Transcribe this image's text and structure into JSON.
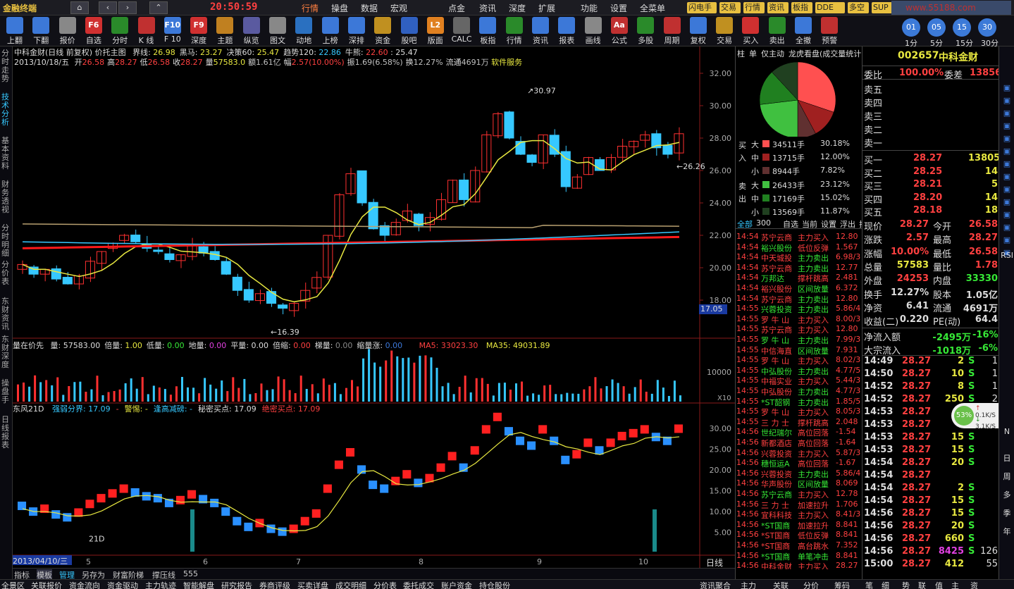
{
  "app": {
    "brand": "金融终端",
    "clock": "20:50:59"
  },
  "topmenu": [
    "行情",
    "操盘",
    "数据",
    "宏观",
    "点金",
    "资讯",
    "深度",
    "扩展",
    "功能",
    "设置",
    "全菜单"
  ],
  "toptags": [
    "闪电手",
    "交易",
    "行情",
    "资讯",
    "板指",
    "DDE",
    "多空",
    "SUP",
    "博弈",
    "驱动力"
  ],
  "watermark": "www.55188.com",
  "toolbar": [
    {
      "label": "上翻",
      "icon": "arrow-up-icon",
      "color": "#3c78d8"
    },
    {
      "label": "下翻",
      "icon": "arrow-down-icon",
      "color": "#3c78d8"
    },
    {
      "label": "报价",
      "icon": "quote-icon",
      "color": "#888"
    },
    {
      "label": "自选",
      "icon": "F6",
      "color": "#d03030"
    },
    {
      "label": "分时",
      "icon": "timeshare-icon",
      "color": "#2a8a2a"
    },
    {
      "label": "K 线",
      "icon": "kline-icon",
      "color": "#c03030"
    },
    {
      "label": "F 10",
      "icon": "F10",
      "color": "#3c78d8"
    },
    {
      "label": "深度",
      "icon": "F9",
      "color": "#d03030"
    },
    {
      "label": "主题",
      "icon": "theme-icon",
      "color": "#c08020"
    },
    {
      "label": "纵览",
      "icon": "overview-icon",
      "color": "#5a5aa0"
    },
    {
      "label": "图文",
      "icon": "graphic-icon",
      "color": "#888"
    },
    {
      "label": "动地",
      "icon": "dynamic-icon",
      "color": "#2a70c0"
    },
    {
      "label": "上榜",
      "icon": "rank-icon",
      "color": "#3c78d8"
    },
    {
      "label": "深排",
      "icon": "sort-icon",
      "color": "#3c78d8"
    },
    {
      "label": "资金",
      "icon": "fund-icon",
      "color": "#c09020"
    },
    {
      "label": "股吧",
      "icon": "forum-icon",
      "color": "#3060c0"
    },
    {
      "label": "版面",
      "icon": "L2",
      "color": "#e08020"
    },
    {
      "label": "CALC",
      "icon": "calc-icon",
      "color": "#666"
    },
    {
      "label": "板指",
      "icon": "board-icon",
      "color": "#3c78d8"
    },
    {
      "label": "行情",
      "icon": "market-icon",
      "color": "#2a8a2a"
    },
    {
      "label": "资讯",
      "icon": "news-icon",
      "color": "#3c78d8"
    },
    {
      "label": "报表",
      "icon": "report-icon",
      "color": "#3c78d8"
    },
    {
      "label": "画线",
      "icon": "draw-icon",
      "color": "#888"
    },
    {
      "label": "公式",
      "icon": "Aa",
      "color": "#c03030"
    },
    {
      "label": "多股",
      "icon": "multi-icon",
      "color": "#2a8a2a"
    },
    {
      "label": "周期",
      "icon": "period-icon",
      "color": "#c03030"
    },
    {
      "label": "复权",
      "icon": "adjust-icon",
      "color": "#3c78d8"
    },
    {
      "label": "交易",
      "icon": "trade-icon",
      "color": "#c09020"
    },
    {
      "label": "买入",
      "icon": "buy-icon",
      "color": "#d03030"
    },
    {
      "label": "卖出",
      "icon": "sell-icon",
      "color": "#2a8a2a"
    },
    {
      "label": "全撤",
      "icon": "cancel-icon",
      "color": "#3c78d8"
    },
    {
      "label": "预警",
      "icon": "alert-icon",
      "color": "#c03030"
    }
  ],
  "periods": [
    {
      "n": "01",
      "l": "1分"
    },
    {
      "n": "05",
      "l": "5分"
    },
    {
      "n": "15",
      "l": "15分"
    },
    {
      "n": "30",
      "l": "30分"
    }
  ],
  "lefttabs": [
    "分时走势",
    "技术分析",
    "基本资料",
    "财务透视",
    "分时明细",
    "分价表",
    "东财资讯",
    "东财深度",
    "操盘手",
    "日线报表"
  ],
  "chart": {
    "title": "中科金财(日线 前复权) 价托主图",
    "indicators": [
      {
        "k": "界线",
        "v": "26.98",
        "c": "#e8e840"
      },
      {
        "k": "黑马",
        "v": "23.27",
        "c": "#e8e840"
      },
      {
        "k": "决策60",
        "v": "25.47",
        "c": "#e8e840"
      },
      {
        "k": "趋势120",
        "v": "22.86",
        "c": "#36c8ff"
      },
      {
        "k": "牛熊",
        "v": "22.60",
        "c": "#ff4040"
      }
    ],
    "extra": "25.47",
    "info_date": "2013/10/18/五",
    "info": [
      {
        "k": "开",
        "v": "26.58",
        "c": "#ff4040"
      },
      {
        "k": "高",
        "v": "28.27",
        "c": "#ff4040"
      },
      {
        "k": "低",
        "v": "26.58",
        "c": "#ff4040"
      },
      {
        "k": "收",
        "v": "28.27",
        "c": "#ff4040"
      },
      {
        "k": "量",
        "v": "57583.0",
        "c": "#e8e840"
      },
      {
        "k": "额",
        "v": "1.61亿",
        "c": "#c0c0c0"
      },
      {
        "k": "幅",
        "v": "2.57(10.00%)",
        "c": "#ff4040"
      },
      {
        "k": "振",
        "v": "1.69(6.58%)",
        "c": "#c0c0c0"
      },
      {
        "k": "换",
        "v": "12.27%",
        "c": "#c0c0c0"
      },
      {
        "k": "流通",
        "v": "4691万",
        "c": "#c0c0c0"
      }
    ],
    "sector": "软件服务",
    "yticks": [
      "32.00",
      "30.00",
      "28.00",
      "26.00",
      "24.00",
      "22.00",
      "20.00",
      "18.00"
    ],
    "high_label": "30.97",
    "low_label": "16.39",
    "last_label": "26.26",
    "cursor_price": "17.05",
    "vol_title": "量在价先",
    "vol_items": [
      {
        "k": "量",
        "v": "57583.00",
        "c": "#ddd"
      },
      {
        "k": "倍量",
        "v": "1.00",
        "c": "#e8e840"
      },
      {
        "k": "低量",
        "v": "0.00",
        "c": "#36e836"
      },
      {
        "k": "地量",
        "v": "0.00",
        "c": "#e040e0"
      },
      {
        "k": "平量",
        "v": "0.00",
        "c": "#ddd"
      },
      {
        "k": "倍缩",
        "v": "0.00",
        "c": "#ff4040"
      },
      {
        "k": "梯量",
        "v": "0.00",
        "c": "#888"
      },
      {
        "k": "缩量涨",
        "v": "0.00",
        "c": "#3c78d8"
      }
    ],
    "ma5": "MA5: 33023.30",
    "ma35": "MA35: 49031.89",
    "vol_ytick": "10000",
    "vol_unit": "X10",
    "ind_title": "东风21D",
    "ind_items": [
      {
        "t": "强弱分界: 17.09",
        "c": "#36c8ff"
      },
      {
        "t": "-",
        "c": "#ff4040"
      },
      {
        "t": "警惕: -",
        "c": "#e8e840"
      },
      {
        "t": "逢高减磅: -",
        "c": "#36c8ff"
      },
      {
        "t": "秘密买点: 17.09",
        "c": "#ddd"
      },
      {
        "t": "绝密买点: 17.09",
        "c": "#ff4040"
      }
    ],
    "ind_yticks": [
      "30.00",
      "25.00",
      "20.00",
      "15.00",
      "10.00",
      "5.00"
    ],
    "ind_label": "21D",
    "date_cursor": "2013/04/10/三",
    "date_ticks": [
      "5",
      "6",
      "7",
      "8",
      "9",
      "10"
    ],
    "period": "日线"
  },
  "bottomtabs": [
    "指标",
    "模板",
    "管理",
    "另存为",
    "财富阶梯",
    "撑压线",
    "555"
  ],
  "statusbar": [
    "全景区",
    "关联报价",
    "资金流向",
    "资金驱动",
    "主力轨迹",
    "智能解盘",
    "研究报告",
    "券商评级",
    "买卖详盘",
    "成交明细",
    "分价表",
    "委托成交",
    "账户资金",
    "持仓股份"
  ],
  "statusbar_right": [
    "资讯聚合",
    "主力",
    "关联",
    "分价",
    "筹码",
    "笔",
    "细",
    "势",
    "联",
    "值",
    "主",
    "资"
  ],
  "mid": {
    "tabs": [
      "柱",
      "单",
      "仅主动",
      "龙虎看盘(成交量统计)"
    ],
    "flow_in": {
      "side": "买入",
      "rows": [
        {
          "k": "大",
          "v": "34511手",
          "p": "30.18%",
          "c": "#ff5050"
        },
        {
          "k": "中",
          "v": "13715手",
          "p": "12.00%",
          "c": "#a02020"
        },
        {
          "k": "小",
          "v": "8944手",
          "p": "7.82%",
          "c": "#603030"
        }
      ]
    },
    "flow_out": {
      "side": "卖出",
      "rows": [
        {
          "k": "大",
          "v": "26433手",
          "p": "23.12%",
          "c": "#40c040"
        },
        {
          "k": "中",
          "v": "17169手",
          "p": "15.02%",
          "c": "#208020"
        },
        {
          "k": "小",
          "v": "13569手",
          "p": "11.87%",
          "c": "#204020"
        }
      ]
    },
    "pie": [
      30.18,
      12.0,
      7.82,
      23.12,
      15.02,
      11.87
    ],
    "list_tabs": [
      "全部",
      "300",
      "自选",
      "当前",
      "设置",
      "浮出",
      "折"
    ],
    "list": [
      [
        "14:54",
        "苏宁云商",
        "主力买入",
        "12.80"
      ],
      [
        "14:54",
        "裕兴股份",
        "低位反弹",
        "1.567"
      ],
      [
        "14:54",
        "中天城投",
        "主力卖出",
        "6.98/3"
      ],
      [
        "14:54",
        "苏宁云商",
        "主力卖出",
        "12.77"
      ],
      [
        "14:54",
        "万邦达",
        "撑杆跳高",
        "2.481"
      ],
      [
        "14:54",
        "裕兴股份",
        "区间放量",
        "6.372"
      ],
      [
        "14:54",
        "苏宁云商",
        "主力卖出",
        "12.80"
      ],
      [
        "14:55",
        "兴蓉投资",
        "主力卖出",
        "5.86/4"
      ],
      [
        "14:55",
        "罗 牛 山",
        "主力买入",
        "8.00/3"
      ],
      [
        "14:55",
        "苏宁云商",
        "主力买入",
        "12.80"
      ],
      [
        "14:55",
        "罗 牛 山",
        "主力卖出",
        "7.99/3"
      ],
      [
        "14:55",
        "中信海直",
        "区间放量",
        "7.931"
      ],
      [
        "14:55",
        "罗 牛 山",
        "主力买入",
        "8.02/3"
      ],
      [
        "14:55",
        "中弘股份",
        "主力卖出",
        "4.77/5"
      ],
      [
        "14:55",
        "中福实业",
        "主力买入",
        "5.44/3"
      ],
      [
        "14:55",
        "中弘股份",
        "主力卖出",
        "4.77/3"
      ],
      [
        "14:55",
        "*ST韶钢",
        "主力卖出",
        "1.85/5"
      ],
      [
        "14:55",
        "罗 牛 山",
        "主力买入",
        "8.05/3"
      ],
      [
        "14:55",
        "三 力 士",
        "撑杆跳高",
        "2.048"
      ],
      [
        "14:56",
        "世纪瑞尔",
        "高位回落",
        "-1.54"
      ],
      [
        "14:56",
        "新都酒店",
        "高位回落",
        "-1.64"
      ],
      [
        "14:56",
        "兴蓉投资",
        "主力买入",
        "5.87/3"
      ],
      [
        "14:56",
        "穗恒运A",
        "高位回落",
        "-1.67"
      ],
      [
        "14:56",
        "兴蓉投资",
        "主力卖出",
        "5.86/4"
      ],
      [
        "14:56",
        "华声股份",
        "区间放量",
        "8.069"
      ],
      [
        "14:56",
        "苏宁云商",
        "主力买入",
        "12.78"
      ],
      [
        "14:56",
        "三 力 士",
        "加速拉升",
        "1.706"
      ],
      [
        "14:56",
        "宜科科技",
        "主力买入",
        "8.41/3"
      ],
      [
        "14:56",
        "*ST国商",
        "加速拉升",
        "8.841"
      ],
      [
        "14:56",
        "*ST国商",
        "低位反弹",
        "8.841"
      ],
      [
        "14:56",
        "*ST国商",
        "高台跳水",
        "7.352"
      ],
      [
        "14:56",
        "*ST国商",
        "单笔冲击",
        "8.841"
      ],
      [
        "14:56",
        "中科金财",
        "主力买入",
        "28.27"
      ]
    ]
  },
  "right": {
    "code": "002657",
    "name": "中科金财",
    "weibi": {
      "k": "委比",
      "v": "100.00%",
      "k2": "委差",
      "v2": "13856"
    },
    "sells": [
      {
        "k": "卖五",
        "p": "",
        "v": ""
      },
      {
        "k": "卖四",
        "p": "",
        "v": ""
      },
      {
        "k": "卖三",
        "p": "",
        "v": ""
      },
      {
        "k": "卖二",
        "p": "",
        "v": ""
      },
      {
        "k": "卖一",
        "p": "",
        "v": ""
      }
    ],
    "buys": [
      {
        "k": "买一",
        "p": "28.27",
        "v": "13805"
      },
      {
        "k": "买二",
        "p": "28.25",
        "v": "14"
      },
      {
        "k": "买三",
        "p": "28.21",
        "v": "5"
      },
      {
        "k": "买四",
        "p": "28.20",
        "v": "14"
      },
      {
        "k": "买五",
        "p": "28.18",
        "v": "18"
      }
    ],
    "stats": [
      {
        "a": "现价",
        "b": "28.27",
        "bc": "#ff4040",
        "c": "今开",
        "d": "26.58",
        "dc": "#ff4040"
      },
      {
        "a": "涨跌",
        "b": "2.57",
        "bc": "#ff4040",
        "c": "最高",
        "d": "28.27",
        "dc": "#ff4040"
      },
      {
        "a": "涨幅",
        "b": "10.00%",
        "bc": "#ff4040",
        "c": "最低",
        "d": "26.58",
        "dc": "#ff4040"
      },
      {
        "a": "总量",
        "b": "57583",
        "bc": "#e8e840",
        "c": "量比",
        "d": "1.78",
        "dc": "#ff4040"
      },
      {
        "a": "外盘",
        "b": "24253",
        "bc": "#ff4040",
        "c": "内盘",
        "d": "33330",
        "dc": "#36e836"
      },
      {
        "a": "换手",
        "b": "12.27%",
        "bc": "#ddd",
        "c": "股本",
        "d": "1.05亿",
        "dc": "#ddd"
      },
      {
        "a": "净资",
        "b": "6.41",
        "bc": "#ddd",
        "c": "流通",
        "d": "4691万",
        "dc": "#ddd"
      },
      {
        "a": "收益(二)",
        "b": "0.220",
        "bc": "#ddd",
        "c": "PE(动)",
        "d": "64.4",
        "dc": "#ddd"
      }
    ],
    "netflow": [
      {
        "k": "净流入额",
        "v": "-2495万",
        "p": "-16%"
      },
      {
        "k": "大宗流入",
        "v": "-1018万",
        "p": "-6%"
      }
    ],
    "ticks": [
      [
        "14:49",
        "28.27",
        "2",
        "S",
        "1"
      ],
      [
        "14:50",
        "28.27",
        "10",
        "S",
        "1"
      ],
      [
        "14:52",
        "28.27",
        "8",
        "S",
        "1"
      ],
      [
        "14:52",
        "28.27",
        "250",
        "S",
        "2"
      ],
      [
        "14:53",
        "28.27",
        "",
        "",
        ""
      ],
      [
        "14:53",
        "28.27",
        "",
        "",
        ""
      ],
      [
        "14:53",
        "28.27",
        "15",
        "S",
        ""
      ],
      [
        "14:53",
        "28.27",
        "15",
        "S",
        ""
      ],
      [
        "14:54",
        "28.27",
        "20",
        "S",
        ""
      ],
      [
        "14:54",
        "28.27",
        "",
        "",
        ""
      ],
      [
        "14:54",
        "28.27",
        "2",
        "S",
        ""
      ],
      [
        "14:54",
        "28.27",
        "15",
        "S",
        ""
      ],
      [
        "14:56",
        "28.27",
        "15",
        "S",
        ""
      ],
      [
        "14:56",
        "28.27",
        "20",
        "S",
        ""
      ],
      [
        "14:56",
        "28.27",
        "660",
        "S",
        ""
      ],
      [
        "14:56",
        "28.27",
        "8425",
        "S",
        "126"
      ],
      [
        "15:00",
        "28.27",
        "412",
        "",
        "55"
      ]
    ],
    "speed": {
      "pct": "53%",
      "up": "0.1K/S",
      "down": "3.1K/S"
    }
  },
  "rightstrip": [
    "RSI",
    "N",
    "日",
    "周",
    "多",
    "季",
    "年"
  ]
}
